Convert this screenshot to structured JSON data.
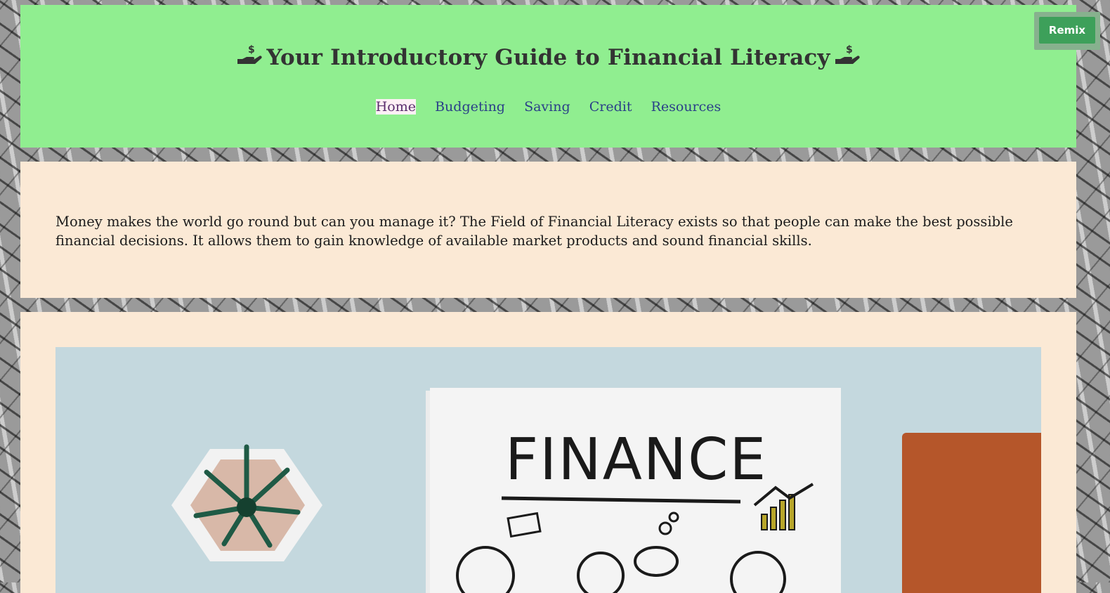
{
  "header": {
    "title": "Your Introductory Guide to Financial Literacy",
    "icon": "hand-holding-dollar-icon",
    "background": "#90ee90"
  },
  "nav": {
    "items": [
      {
        "label": "Home",
        "active": true
      },
      {
        "label": "Budgeting",
        "active": false
      },
      {
        "label": "Saving",
        "active": false
      },
      {
        "label": "Credit",
        "active": false
      },
      {
        "label": "Resources",
        "active": false
      }
    ]
  },
  "intro": {
    "text": "Money makes the world go round but can you manage it? The Field of Financial Literacy exists so that people can make the best possible financial decisions. It allows them to gain knowledge of available market products and sound financial skills."
  },
  "image": {
    "board_text": "FINANCE"
  },
  "remix": {
    "label": "Remix"
  },
  "colors": {
    "panel": "#fbe9d5",
    "nav_link": "#2a3f88",
    "remix": "#3da05a"
  }
}
